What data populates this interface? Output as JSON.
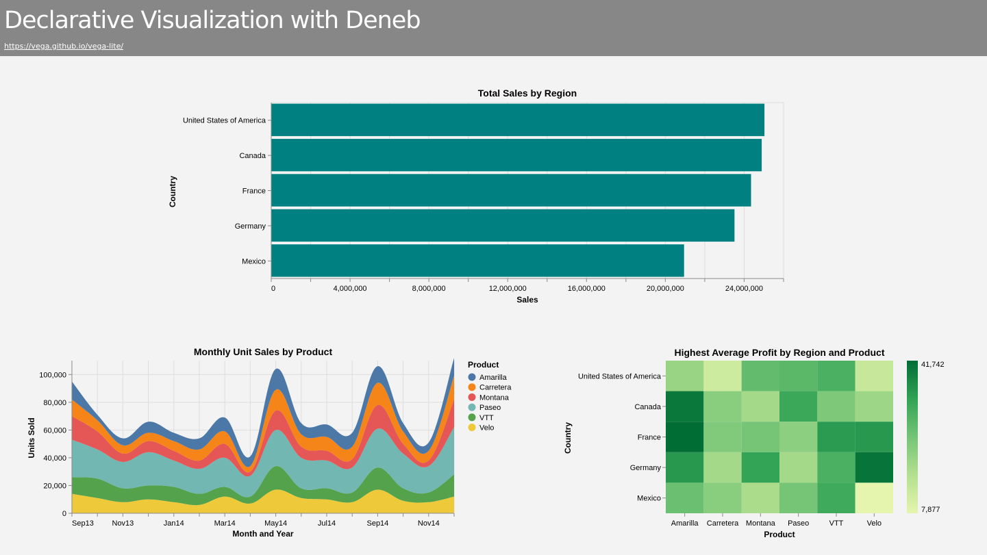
{
  "header": {
    "title": "Declarative Visualization with Deneb",
    "link": "https://vega.github.io/vega-lite/"
  },
  "chart_data": [
    {
      "type": "bar",
      "title": "Total Sales by Region",
      "xlabel": "Sales",
      "ylabel": "Country",
      "categories": [
        "United States of America",
        "Canada",
        "France",
        "Germany",
        "Mexico"
      ],
      "values": [
        25030000,
        24890000,
        24350000,
        23510000,
        20950000
      ],
      "xlim": [
        0,
        26000000
      ],
      "xticks": [
        0,
        4000000,
        8000000,
        12000000,
        16000000,
        20000000,
        24000000
      ],
      "xtick_labels": [
        "0",
        "4,000,000",
        "8,000,000",
        "12,000,000",
        "16,000,000",
        "20,000,000",
        "24,000,000"
      ],
      "color": "#008080",
      "grid": true
    },
    {
      "type": "area",
      "stacked": true,
      "interpolation": "smooth",
      "title": "Monthly Unit Sales by Product",
      "xlabel": "Month and Year",
      "ylabel": "Units Sold",
      "legend_title": "Product",
      "legend_position": "right",
      "x": [
        "Sep13",
        "Oct13",
        "Nov13",
        "Dec13",
        "Jan14",
        "Feb14",
        "Mar14",
        "Apr14",
        "May14",
        "Jun14",
        "Jul14",
        "Aug14",
        "Sep14",
        "Oct14",
        "Nov14",
        "Dec14"
      ],
      "xtick_labels": [
        "Sep13",
        "Nov13",
        "Jan14",
        "Mar14",
        "May14",
        "Jul14",
        "Sep14",
        "Nov14"
      ],
      "ylim": [
        0,
        110000
      ],
      "yticks": [
        0,
        20000,
        40000,
        60000,
        80000,
        100000
      ],
      "ytick_labels": [
        "0",
        "20,000",
        "40,000",
        "60,000",
        "80,000",
        "100,000"
      ],
      "series": [
        {
          "name": "Velo",
          "color": "#eeca3b",
          "values": [
            14000,
            11000,
            8000,
            10000,
            8000,
            6000,
            12000,
            7000,
            17000,
            11000,
            10000,
            8000,
            17000,
            9000,
            8000,
            12000
          ]
        },
        {
          "name": "VTT",
          "color": "#54a24b",
          "values": [
            12000,
            14000,
            10000,
            10000,
            11000,
            8000,
            7000,
            5000,
            17000,
            7000,
            8000,
            7000,
            16000,
            9000,
            7000,
            16000
          ]
        },
        {
          "name": "Paseo",
          "color": "#72b7b2",
          "values": [
            27000,
            21000,
            19000,
            24000,
            19000,
            18000,
            21000,
            15000,
            26000,
            22000,
            20000,
            18000,
            28000,
            25000,
            19000,
            34000
          ]
        },
        {
          "name": "Montana",
          "color": "#e45756",
          "values": [
            17000,
            13000,
            6000,
            8000,
            7000,
            6000,
            10000,
            3000,
            14000,
            8000,
            7000,
            6000,
            17000,
            7000,
            4000,
            20000
          ]
        },
        {
          "name": "Carretera",
          "color": "#f58518",
          "values": [
            12000,
            8000,
            6000,
            6000,
            7000,
            8000,
            9000,
            4000,
            15000,
            9000,
            10000,
            9000,
            16000,
            9000,
            7000,
            17000
          ]
        },
        {
          "name": "Amarilla",
          "color": "#4c78a8",
          "values": [
            13000,
            4000,
            5000,
            8000,
            6000,
            8000,
            10000,
            7000,
            15000,
            8000,
            9000,
            10000,
            12000,
            6000,
            6000,
            13000
          ]
        }
      ],
      "grid": true
    },
    {
      "type": "heatmap",
      "title": "Highest Average Profit by Region and Product",
      "xlabel": "Product",
      "ylabel": "Country",
      "x": [
        "Amarilla",
        "Carretera",
        "Montana",
        "Paseo",
        "VTT",
        "Velo"
      ],
      "y": [
        "United States of America",
        "Canada",
        "France",
        "Germany",
        "Mexico"
      ],
      "values": [
        [
          20000,
          12000,
          27000,
          28000,
          30000,
          13000
        ],
        [
          40000,
          22000,
          18500,
          32000,
          23500,
          19500
        ],
        [
          41742,
          23000,
          24500,
          21500,
          34500,
          35000
        ],
        [
          35000,
          18500,
          33000,
          18500,
          30000,
          40500
        ],
        [
          26000,
          22000,
          17500,
          24500,
          31500,
          7877
        ]
      ],
      "colorscale": {
        "min": 7877,
        "max": 41742,
        "min_color": "#e5f5ad",
        "max_color": "#006d35"
      },
      "legend_labels": [
        "41,742",
        "7,877"
      ]
    }
  ]
}
